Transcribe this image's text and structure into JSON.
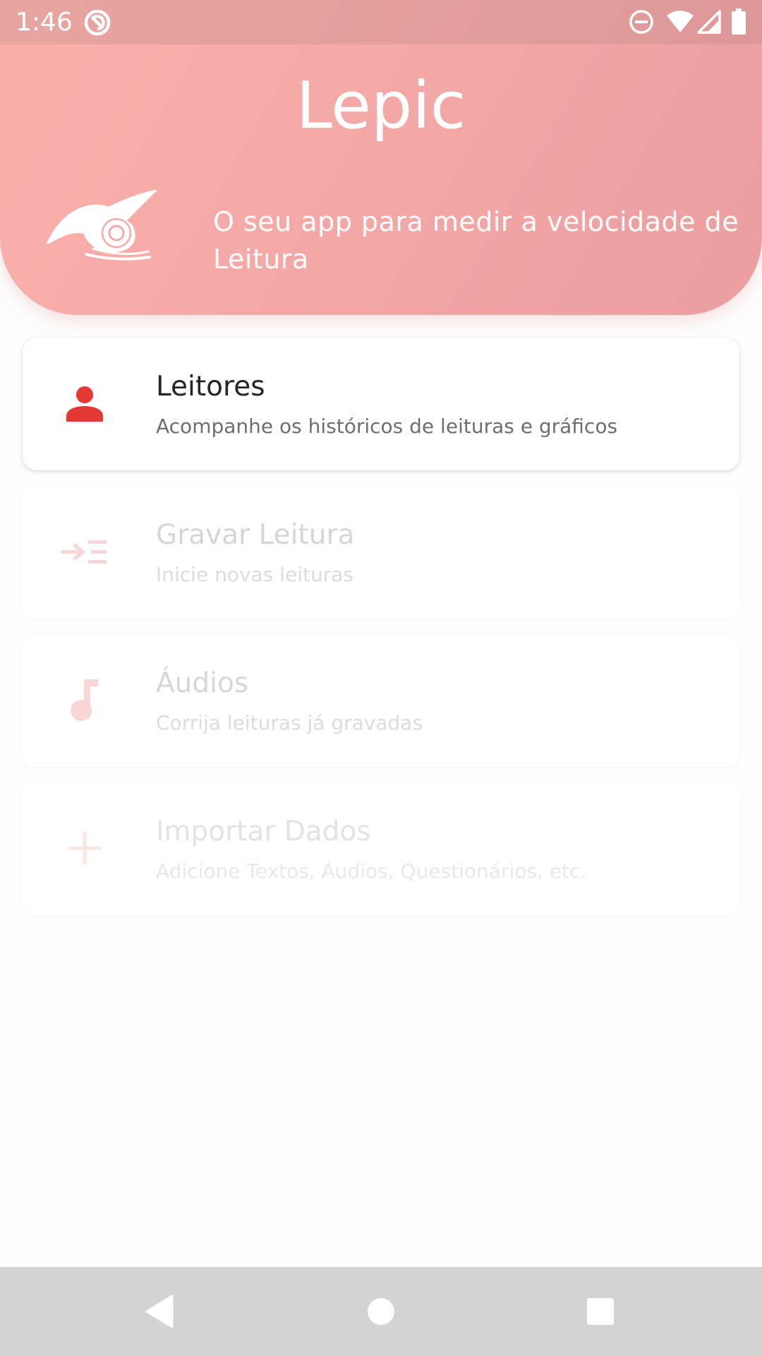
{
  "status_bar": {
    "time": "1:46",
    "icons": [
      "app-notification-icon",
      "do-not-disturb-icon",
      "wifi-icon",
      "signal-icon",
      "battery-icon"
    ]
  },
  "header": {
    "title": "Lepic",
    "tagline": "O seu app para medir a velocidade de Leitura",
    "logo": "snail-logo"
  },
  "menu": {
    "items": [
      {
        "title": "Leitores",
        "subtitle": "Acompanhe os históricos de leituras e gráficos",
        "icon": "person-icon",
        "enabled": true
      },
      {
        "title": "Gravar Leitura",
        "subtitle": "Inicie novas leituras",
        "icon": "record-list-icon",
        "enabled": false
      },
      {
        "title": "Áudios",
        "subtitle": "Corrija leituras já gravadas",
        "icon": "music-note-icon",
        "enabled": false
      },
      {
        "title": "Importar Dados",
        "subtitle": "Adicione Textos, Áudios, Questionários, etc.",
        "icon": "plus-icon",
        "enabled": false
      }
    ]
  },
  "nav_bar": {
    "buttons": [
      "back-icon",
      "home-icon",
      "recents-icon"
    ]
  },
  "colors": {
    "accent": "#e53935",
    "header_gradient_start": "#fbb1ab",
    "header_gradient_end": "#ec9ea1",
    "disabled_icon": "#f8d6d6",
    "nav_bar": "#d3d3d3"
  }
}
